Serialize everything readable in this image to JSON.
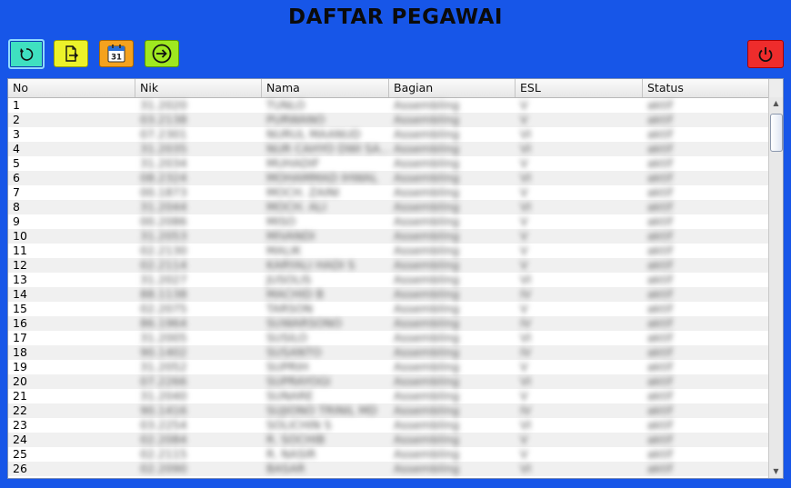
{
  "window": {
    "title": "DAFTAR PEGAWAI"
  },
  "toolbar": {
    "refresh_icon": "refresh-icon",
    "export_icon": "export-document-icon",
    "calendar_icon": "calendar-icon",
    "calendar_day": "31",
    "enter_icon": "enter-icon",
    "power_icon": "power-icon"
  },
  "colors": {
    "background": "#1756e8",
    "refresh": "#3fe0c0",
    "export": "#ecf22a",
    "calendar": "#f5a21e",
    "enter": "#9fe820",
    "power": "#ee2c2c"
  },
  "table": {
    "columns": [
      "No",
      "Nik",
      "Nama",
      "Bagian",
      "ESL",
      "Status"
    ],
    "rows": [
      {
        "no": "1",
        "nik": "31.2020",
        "nama": "TUNLO",
        "bagian": "Assembling",
        "esl": "V",
        "status": "aktif"
      },
      {
        "no": "2",
        "nik": "03.2138",
        "nama": "PURWANO",
        "bagian": "Assembling",
        "esl": "V",
        "status": "aktif"
      },
      {
        "no": "3",
        "nik": "07.2301",
        "nama": "NURUL MAANUD",
        "bagian": "Assembling",
        "esl": "VI",
        "status": "aktif"
      },
      {
        "no": "4",
        "nik": "31.2035",
        "nama": "NUR CAHYO DWI SA...",
        "bagian": "Assembling",
        "esl": "VI",
        "status": "aktif"
      },
      {
        "no": "5",
        "nik": "31.2034",
        "nama": "MUHADIF",
        "bagian": "Assembling",
        "esl": "V",
        "status": "aktif"
      },
      {
        "no": "6",
        "nik": "08.2324",
        "nama": "MOHAMMAD IHWAL",
        "bagian": "Assembling",
        "esl": "VI",
        "status": "aktif"
      },
      {
        "no": "7",
        "nik": "00.1873",
        "nama": "MOCH. ZAINI",
        "bagian": "Assembling",
        "esl": "V",
        "status": "aktif"
      },
      {
        "no": "8",
        "nik": "31.2044",
        "nama": "MOCH. ALI",
        "bagian": "Assembling",
        "esl": "VI",
        "status": "aktif"
      },
      {
        "no": "9",
        "nik": "00.2086",
        "nama": "MISO",
        "bagian": "Assembling",
        "esl": "V",
        "status": "aktif"
      },
      {
        "no": "10",
        "nik": "31.2053",
        "nama": "MIVANDI",
        "bagian": "Assembling",
        "esl": "V",
        "status": "aktif"
      },
      {
        "no": "11",
        "nik": "02.2130",
        "nama": "MALIK",
        "bagian": "Assembling",
        "esl": "V",
        "status": "aktif"
      },
      {
        "no": "12",
        "nik": "02.2114",
        "nama": "KARYALI HADI S",
        "bagian": "Assembling",
        "esl": "V",
        "status": "aktif"
      },
      {
        "no": "13",
        "nik": "31.2027",
        "nama": "JUSOLIS",
        "bagian": "Assembling",
        "esl": "VI",
        "status": "aktif"
      },
      {
        "no": "14",
        "nik": "88.1138",
        "nama": "MACHID B",
        "bagian": "Assembling",
        "esl": "IV",
        "status": "aktif"
      },
      {
        "no": "15",
        "nik": "02.2075",
        "nama": "TARSON",
        "bagian": "Assembling",
        "esl": "V",
        "status": "aktif"
      },
      {
        "no": "16",
        "nik": "86.1964",
        "nama": "SUWARSONO",
        "bagian": "Assembling",
        "esl": "IV",
        "status": "aktif"
      },
      {
        "no": "17",
        "nik": "31.2005",
        "nama": "SUSILO",
        "bagian": "Assembling",
        "esl": "VI",
        "status": "aktif"
      },
      {
        "no": "18",
        "nik": "90.1402",
        "nama": "SUSANTO",
        "bagian": "Assembling",
        "esl": "IV",
        "status": "aktif"
      },
      {
        "no": "19",
        "nik": "31.2052",
        "nama": "SUPRIH",
        "bagian": "Assembling",
        "esl": "V",
        "status": "aktif"
      },
      {
        "no": "20",
        "nik": "07.2266",
        "nama": "SUPRAYOGI",
        "bagian": "Assembling",
        "esl": "VI",
        "status": "aktif"
      },
      {
        "no": "21",
        "nik": "31.2040",
        "nama": "SUNARE",
        "bagian": "Assembling",
        "esl": "V",
        "status": "aktif"
      },
      {
        "no": "22",
        "nik": "90.1416",
        "nama": "SUJIONO TRINIL MD",
        "bagian": "Assembling",
        "esl": "IV",
        "status": "aktif"
      },
      {
        "no": "23",
        "nik": "03.2254",
        "nama": "SOLICHIN S",
        "bagian": "Assembling",
        "esl": "VI",
        "status": "aktif"
      },
      {
        "no": "24",
        "nik": "02.2084",
        "nama": "R. SOCHIB",
        "bagian": "Assembling",
        "esl": "V",
        "status": "aktif"
      },
      {
        "no": "25",
        "nik": "02.2115",
        "nama": "R. NASIR",
        "bagian": "Assembling",
        "esl": "V",
        "status": "aktif"
      },
      {
        "no": "26",
        "nik": "02.2090",
        "nama": "BASAR",
        "bagian": "Assembling",
        "esl": "VI",
        "status": "aktif"
      }
    ]
  }
}
